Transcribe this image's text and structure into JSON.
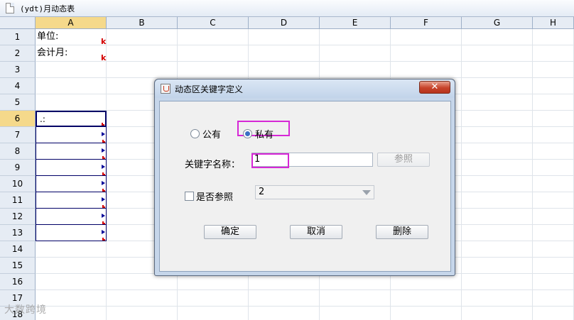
{
  "window": {
    "title": "(ydt)月动态表"
  },
  "sheet": {
    "columns": [
      "A",
      "B",
      "C",
      "D",
      "E",
      "F",
      "G",
      "H"
    ],
    "active_column": "A",
    "rows": [
      "1",
      "2",
      "3",
      "4",
      "5",
      "6",
      "7",
      "8",
      "9",
      "10",
      "11",
      "12",
      "13",
      "14",
      "15",
      "16",
      "17",
      "18"
    ],
    "active_row": "6",
    "cells": {
      "A1": "单位:",
      "A2": "会计月:",
      "A6": ".:"
    },
    "cell_marks": {
      "k": "k"
    }
  },
  "dialog": {
    "title": "动态区关键字定义",
    "close_label": "✕",
    "radio_public": "公有",
    "radio_private": "私有",
    "selected_radio": "私有",
    "keyword_name_label": "关键字名称：",
    "keyword_name_value": "1",
    "reference_button": "参照",
    "is_reference_label": "是否参照",
    "is_reference_checked": false,
    "select_value": "2",
    "ok_button": "确定",
    "cancel_button": "取消",
    "delete_button": "删除"
  },
  "watermark": "大数跨境",
  "colors": {
    "highlight": "#d627d6",
    "header_active": "#f5d98b",
    "dynamic_border": "#000066"
  }
}
